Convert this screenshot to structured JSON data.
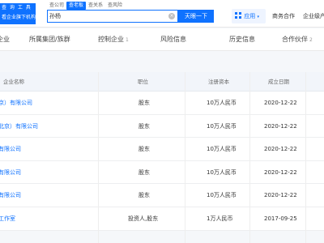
{
  "header": {
    "logo_line1": "查 询 工 具",
    "logo_line2": "看企业旗下机构",
    "search_tabs": [
      "查公司",
      "查老板",
      "查关系",
      "查风险"
    ],
    "active_tab": "查老板",
    "search_value": "孙杨",
    "clear_icon": "×",
    "search_button": "天眼一下",
    "app_label": "应用",
    "nav_links": [
      "商务合作",
      "企业级产"
    ]
  },
  "categories": [
    {
      "label": "企业",
      "count": ""
    },
    {
      "label": "所属集团/族群",
      "count": ""
    },
    {
      "label": "控制企业",
      "count": "1"
    },
    {
      "label": "风险信息",
      "count": ""
    },
    {
      "label": "历史信息",
      "count": ""
    },
    {
      "label": "合作伙伴",
      "count": "2"
    }
  ],
  "table": {
    "headers": [
      "企业名称",
      "职位",
      "注册资本",
      "成立日期"
    ],
    "rows": [
      {
        "name": "京）有限公司",
        "position": "股东",
        "capital": "10万人民币",
        "date": "2020-12-22"
      },
      {
        "name": "北京）有限公司",
        "position": "股东",
        "capital": "10万人民币",
        "date": "2020-12-22"
      },
      {
        "name": "有限公司",
        "position": "股东",
        "capital": "10万人民币",
        "date": "2020-12-22"
      },
      {
        "name": "有限公司",
        "position": "股东",
        "capital": "10万人民币",
        "date": "2020-12-22"
      },
      {
        "name": "有限公司",
        "position": "股东",
        "capital": "10万人民币",
        "date": "2020-12-22"
      },
      {
        "name": "工作室",
        "position": "投资人,股东",
        "capital": "1万人民币",
        "date": "2017-09-25"
      }
    ]
  },
  "colors": {
    "accent": "#0f72ff",
    "header_bg": "#f2f5fa"
  }
}
